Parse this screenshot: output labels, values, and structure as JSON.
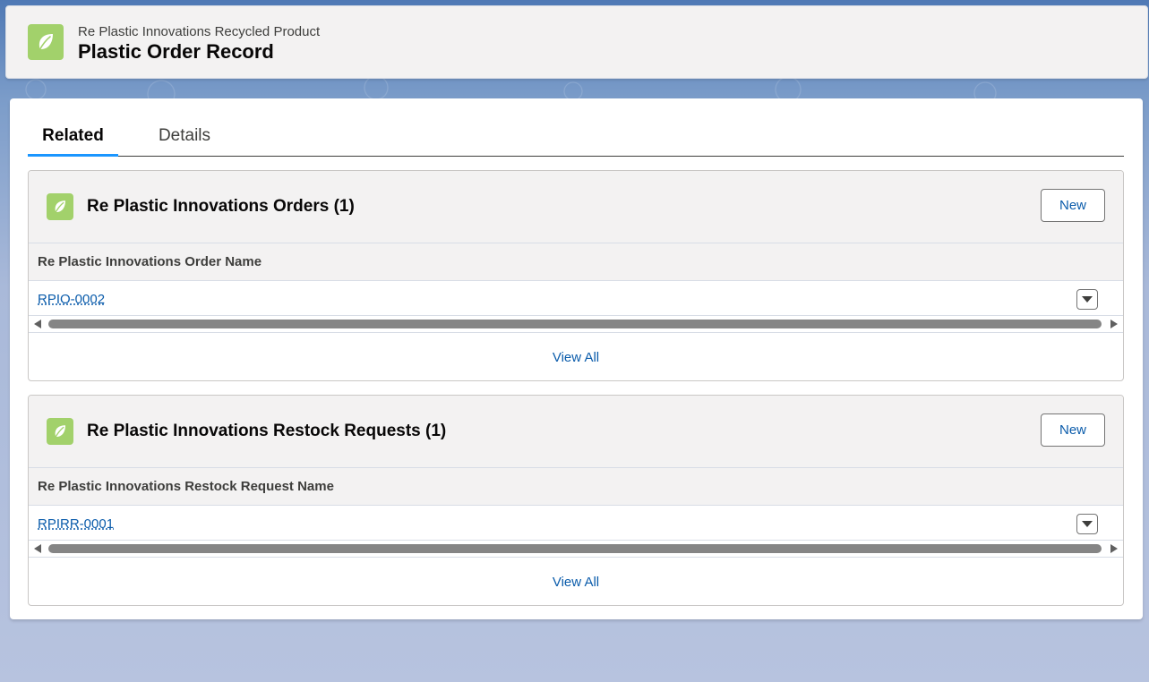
{
  "header": {
    "subtitle": "Re Plastic Innovations Recycled Product",
    "title": "Plastic Order Record",
    "icon": "leaf-icon",
    "icon_color": "#a2d16b"
  },
  "tabs": [
    {
      "label": "Related",
      "active": true
    },
    {
      "label": "Details",
      "active": false
    }
  ],
  "related_lists": [
    {
      "title": "Re Plastic Innovations Orders (1)",
      "icon": "leaf-icon",
      "new_label": "New",
      "column_header": "Re Plastic Innovations Order Name",
      "rows": [
        {
          "name": "RPIO-0002"
        }
      ],
      "view_all_label": "View All"
    },
    {
      "title": "Re Plastic Innovations Restock Requests (1)",
      "icon": "leaf-icon",
      "new_label": "New",
      "column_header": "Re Plastic Innovations Restock Request Name",
      "rows": [
        {
          "name": "RPIRR-0001"
        }
      ],
      "view_all_label": "View All"
    }
  ],
  "colors": {
    "accent": "#1b96ff",
    "link": "#0b5cab",
    "icon_bg": "#a2d16b"
  }
}
